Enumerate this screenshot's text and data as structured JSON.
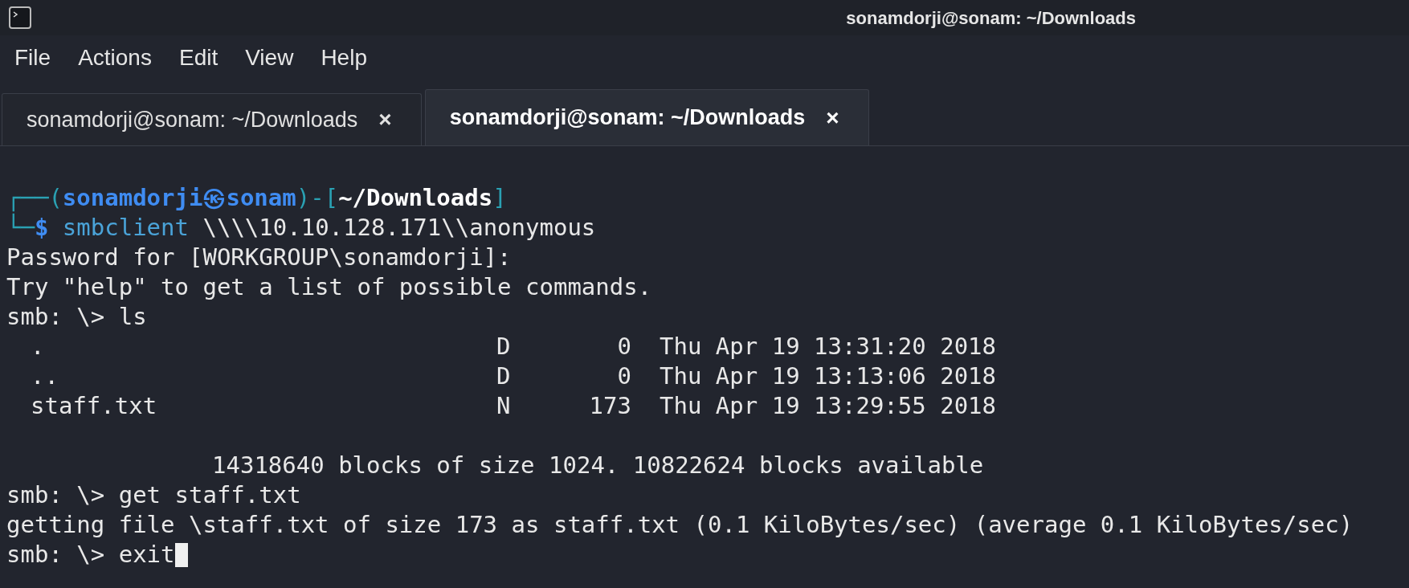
{
  "window": {
    "title": "sonamdorji@sonam: ~/Downloads"
  },
  "menu": [
    "File",
    "Actions",
    "Edit",
    "View",
    "Help"
  ],
  "tabs": [
    {
      "label": "sonamdorji@sonam: ~/Downloads",
      "close": "×",
      "selected": false
    },
    {
      "label": "sonamdorji@sonam: ~/Downloads",
      "close": "×",
      "selected": true
    }
  ],
  "terminal": {
    "prompt": {
      "open": "┌──(",
      "user": "sonamdorji",
      "at": "㉿",
      "host": "sonam",
      "mid": ")-[",
      "path": "~/Downloads",
      "close": "]",
      "corner": "└─",
      "symbol": "$",
      "program": "smbclient",
      "args": "\\\\\\\\10.10.128.171\\\\anonymous"
    },
    "lines": [
      {
        "kind": "text",
        "text": "Password for [WORKGROUP\\sonamdorji]:"
      },
      {
        "kind": "text",
        "text": "Try \"help\" to get a list of possible commands."
      },
      {
        "kind": "text",
        "text": "smb: \\> ls"
      },
      {
        "kind": "listing",
        "rows": [
          {
            "name": ".",
            "attr": "D",
            "size": "0",
            "date": "Thu Apr 19 13:31:20 2018"
          },
          {
            "name": "..",
            "attr": "D",
            "size": "0",
            "date": "Thu Apr 19 13:13:06 2018"
          },
          {
            "name": "staff.txt",
            "attr": "N",
            "size": "173",
            "date": "Thu Apr 19 13:29:55 2018"
          }
        ]
      },
      {
        "kind": "blank"
      },
      {
        "kind": "indented",
        "text": "14318640 blocks of size 1024. 10822624 blocks available"
      },
      {
        "kind": "text",
        "text": "smb: \\> get staff.txt"
      },
      {
        "kind": "text",
        "text": "getting file \\staff.txt of size 173 as staff.txt (0.1 KiloBytes/sec) (average 0.1 KiloBytes/sec)"
      },
      {
        "kind": "input",
        "text": "smb: \\> exit",
        "cursor": true
      }
    ]
  }
}
